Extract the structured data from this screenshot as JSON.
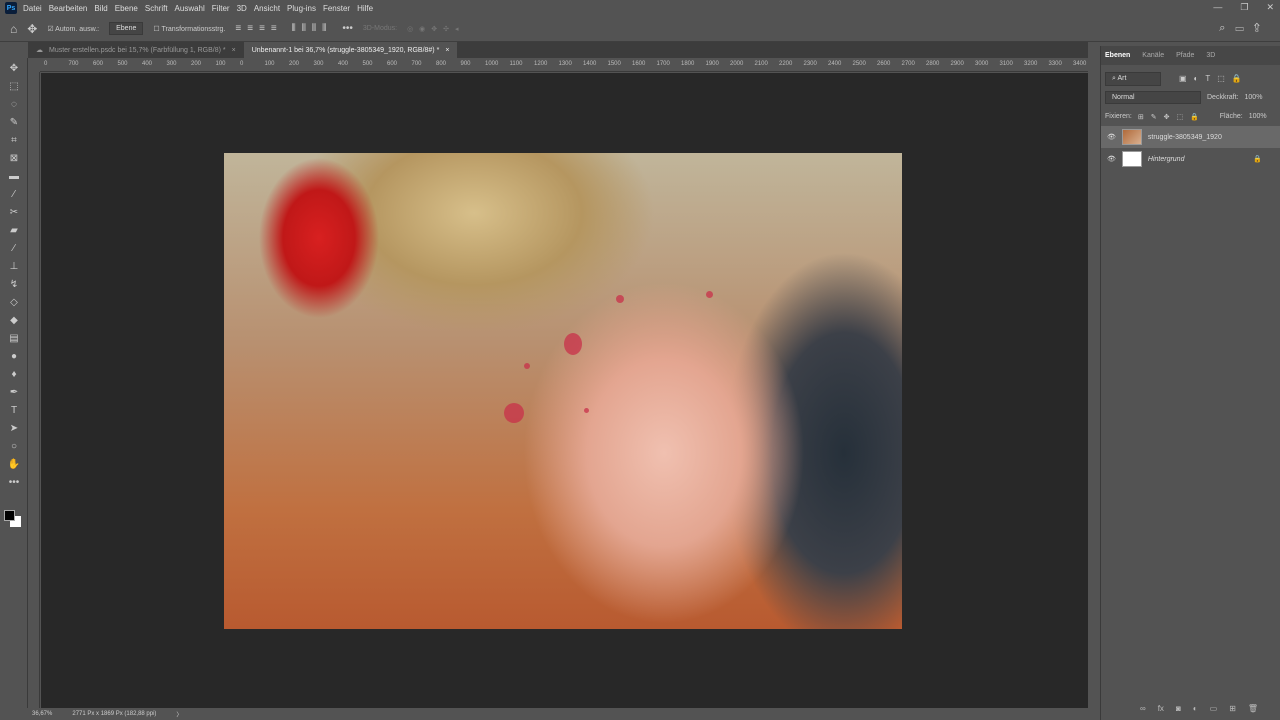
{
  "app": {
    "logo": "Ps"
  },
  "menu": [
    "Datei",
    "Bearbeiten",
    "Bild",
    "Ebene",
    "Schrift",
    "Auswahl",
    "Filter",
    "3D",
    "Ansicht",
    "Plug-ins",
    "Fenster",
    "Hilfe"
  ],
  "options": {
    "auto_select": "Autom. ausw.:",
    "layer_select": "Ebene",
    "transform": "Transformationsstrg.",
    "more": "•••",
    "mode_3d": "3D-Modus:"
  },
  "tabs": [
    {
      "label": "Muster erstellen.psdc bei 15,7% (Farbfüllung 1, RGB/8) *",
      "active": false
    },
    {
      "label": "Unbenannt-1 bei 36,7% (struggle-3805349_1920, RGB/8#) *",
      "active": true
    }
  ],
  "ruler": [
    "0",
    "700",
    "600",
    "500",
    "400",
    "300",
    "200",
    "100",
    "0",
    "100",
    "200",
    "300",
    "400",
    "500",
    "600",
    "700",
    "800",
    "900",
    "1000",
    "1100",
    "1200",
    "1300",
    "1400",
    "1500",
    "1600",
    "1700",
    "1800",
    "1900",
    "2000",
    "2100",
    "2200",
    "2300",
    "2400",
    "2500",
    "2600",
    "2700",
    "2800",
    "2900",
    "3000",
    "3100",
    "3200",
    "3300",
    "3400"
  ],
  "layers_panel": {
    "tabs": [
      "Ebenen",
      "Kanäle",
      "Pfade",
      "3D"
    ],
    "filter": "Art",
    "blend_mode": "Normal",
    "opacity_label": "Deckkraft:",
    "opacity": "100%",
    "lock_label": "Fixieren:",
    "fill_label": "Fläche:",
    "fill": "100%",
    "layers": [
      {
        "name": "struggle-3805349_1920",
        "visible": true,
        "selected": true
      },
      {
        "name": "Hintergrund",
        "visible": true,
        "locked": true
      }
    ]
  },
  "status": {
    "zoom": "36,67%",
    "doc": "2771 Px x 1869 Px (182,88 ppi)",
    "arrow": "〉"
  }
}
